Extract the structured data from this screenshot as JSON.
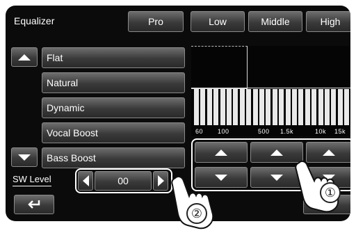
{
  "header": {
    "title": "Equalizer",
    "pro_label": "Pro",
    "tabs": [
      "Low",
      "Middle",
      "High"
    ]
  },
  "presets": [
    "Flat",
    "Natural",
    "Dynamic",
    "Vocal Boost",
    "Bass Boost"
  ],
  "sw_level": {
    "label": "SW Level",
    "value": "00"
  },
  "eq": {
    "freq_labels": [
      "60",
      "100",
      "500",
      "1.5k",
      "10k",
      "15k"
    ]
  },
  "callouts": {
    "one": "①",
    "two": "②"
  },
  "icons": {
    "up": "up-arrow-icon",
    "down": "down-arrow-icon",
    "back": "back-arrow-icon",
    "left": "left-arrow-icon",
    "right": "right-arrow-icon"
  }
}
